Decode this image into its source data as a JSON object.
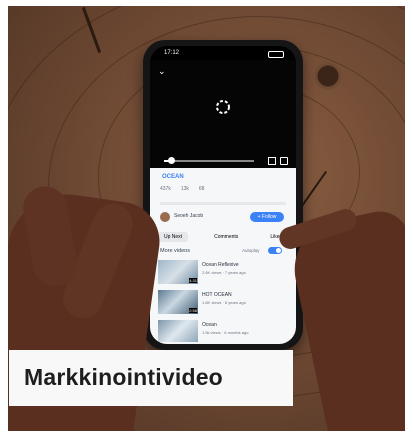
{
  "caption": {
    "text": "Markkinointivideo"
  },
  "phone": {
    "status_time": "17:12",
    "video_title": "OCEAN",
    "stats": [
      "437k",
      "13k",
      "68"
    ],
    "channel_name": "Seoeh Jacob",
    "follow_label": "+ Follow",
    "tabs": [
      "Up Next",
      "Comments",
      "Likes"
    ],
    "section_title": "More videos",
    "autoplay_label": "Autoplay",
    "videos": [
      {
        "title": "Ocean Reflexive",
        "meta": "2.6K views · 7 years ago",
        "duration": "4:31"
      },
      {
        "title": "HOT OCEAN",
        "meta": "1.6K views · 6 years ago",
        "duration": "2:56"
      },
      {
        "title": "Ocean",
        "meta": "1.5k views · 6 months ago",
        "duration": ""
      }
    ],
    "colors": {
      "accent": "#3b82f6",
      "wood": "#7a5139",
      "skin": "#5a2f1f"
    }
  }
}
